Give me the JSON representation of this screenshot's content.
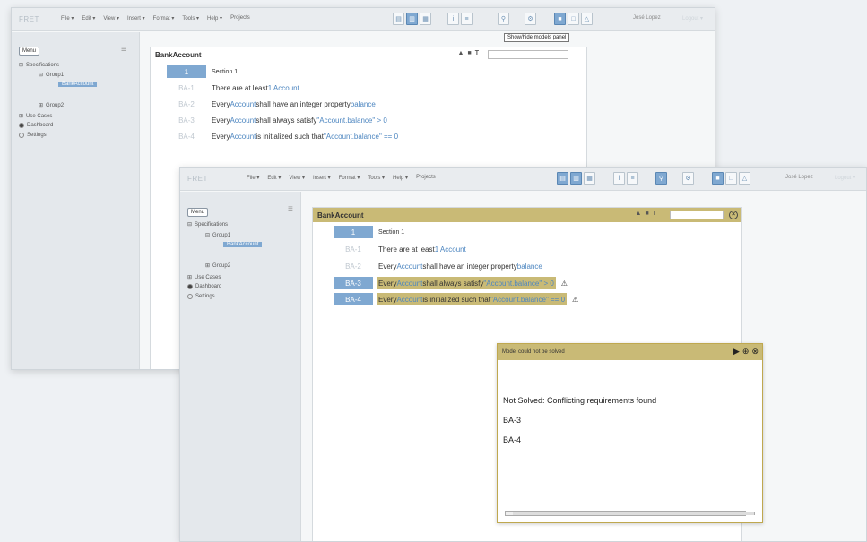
{
  "app": {
    "brand": "FRET",
    "user": "José Lopez",
    "logout": "Logout ▾"
  },
  "menu": [
    "File ▾",
    "Edit ▾",
    "View ▾",
    "Insert ▾",
    "Format ▾",
    "Tools ▾",
    "Help ▾",
    "Projects"
  ],
  "sidebar": {
    "button": "Menu",
    "items": [
      "Specifications",
      "Group1",
      "BankAccount",
      "Group2",
      "Use Cases",
      "Dashboard",
      "Settings"
    ]
  },
  "tooltip": "Show/hide models panel",
  "back_panel": {
    "title": "BankAccount",
    "section_id": "1",
    "section_label": "Section 1",
    "reqs": [
      {
        "id": "BA-1",
        "pre": "There are at least ",
        "kw": "1 Account",
        "post": ""
      },
      {
        "id": "BA-2",
        "pre": "Every ",
        "kw": "Account",
        "mid": " shall have an integer property ",
        "kw2": "balance",
        "post": ""
      },
      {
        "id": "BA-3",
        "pre": "Every ",
        "kw": "Account",
        "mid": " shall always satisfy ",
        "kw2": "\"Account.balance\" > 0",
        "post": ""
      },
      {
        "id": "BA-4",
        "pre": "Every ",
        "kw": "Account",
        "mid": " is initialized such that ",
        "kw2": "\"Account.balance\" == 0",
        "post": ""
      }
    ]
  },
  "front_panel": {
    "title": "BankAccount",
    "section_id": "1",
    "section_label": "Section 1",
    "reqs": [
      {
        "id": "BA-1",
        "pre": "There are at least ",
        "kw": "1 Account",
        "post": ""
      },
      {
        "id": "BA-2",
        "pre": "Every ",
        "kw": "Account",
        "mid": " shall have an integer property ",
        "kw2": "balance",
        "post": ""
      },
      {
        "id": "BA-3",
        "pre": "Every ",
        "kw": "Account",
        "mid": " shall always satisfy ",
        "kw2": "\"Account.balance\" > 0",
        "post": ""
      },
      {
        "id": "BA-4",
        "pre": "Every ",
        "kw": "Account",
        "mid": " is initialized such that ",
        "kw2": "\"Account.balance\" == 0",
        "post": ""
      }
    ]
  },
  "dialog": {
    "title": "Model could not be solved",
    "message": "Not Solved: Conflicting requirements found",
    "conflicts": [
      "BA-3",
      "BA-4"
    ]
  },
  "icons": {
    "warning": "warning-icon",
    "play": "play-icon",
    "gear": "gear-icon",
    "close": "close-icon"
  }
}
